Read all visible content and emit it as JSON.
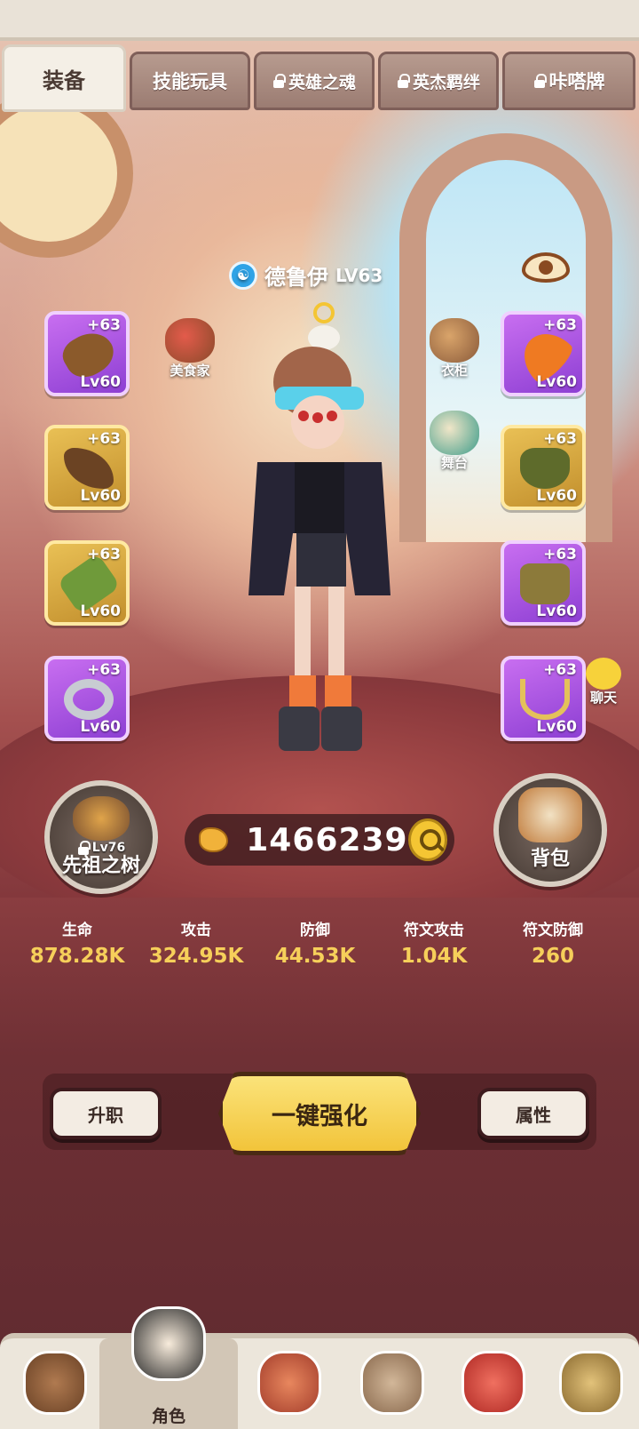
{
  "tabs": [
    {
      "label": "装备",
      "locked": false,
      "active": true
    },
    {
      "label": "技能玩具",
      "locked": false,
      "active": false
    },
    {
      "label": "英雄之魂",
      "locked": true,
      "active": false
    },
    {
      "label": "英杰羁绊",
      "locked": true,
      "active": false
    },
    {
      "label": "咔嗒牌",
      "locked": true,
      "active": false
    }
  ],
  "hero": {
    "name": "德鲁伊",
    "level": "LV63",
    "class_icon": "wind-class-icon"
  },
  "equipment_left": [
    {
      "plus": "+63",
      "level": "Lv60",
      "rarity": "purple",
      "icon": "weapon-staff-icon",
      "color": "#8b5a2b"
    },
    {
      "plus": "+63",
      "level": "Lv60",
      "rarity": "gold",
      "icon": "antler-helmet-icon",
      "color": "#6b4323"
    },
    {
      "plus": "+63",
      "level": "Lv60",
      "rarity": "gold",
      "icon": "bracer-icon",
      "color": "#6f9a3a"
    },
    {
      "plus": "+63",
      "level": "Lv60",
      "rarity": "purple",
      "icon": "ring-icon",
      "color": "#c8ccd2"
    }
  ],
  "equipment_right": [
    {
      "plus": "+63",
      "level": "Lv60",
      "rarity": "purple",
      "icon": "feather-icon",
      "color": "#ef7a22"
    },
    {
      "plus": "+63",
      "level": "Lv60",
      "rarity": "gold",
      "icon": "leaf-armor-icon",
      "color": "#5e6b2b"
    },
    {
      "plus": "+63",
      "level": "Lv60",
      "rarity": "purple",
      "icon": "boots-icon",
      "color": "#8c7a3a"
    },
    {
      "plus": "+63",
      "level": "Lv60",
      "rarity": "purple",
      "icon": "necklace-icon",
      "color": "#e4c15a"
    }
  ],
  "shortcuts": {
    "gourmet": "美食家",
    "wardrobe": "衣柜",
    "stage": "舞台",
    "chat": "聊天"
  },
  "ancestor_tree": {
    "label": "先祖之树",
    "level": "Lv76",
    "locked": true
  },
  "backpack": {
    "label": "背包"
  },
  "power": {
    "value": "1466239"
  },
  "stats": [
    {
      "name": "生命",
      "value": "878.28K"
    },
    {
      "name": "攻击",
      "value": "324.95K"
    },
    {
      "name": "防御",
      "value": "44.53K"
    },
    {
      "name": "符文攻击",
      "value": "1.04K"
    },
    {
      "name": "符文防御",
      "value": "260"
    }
  ],
  "actions": {
    "promote": "升职",
    "enhance_all": "一键强化",
    "attributes": "属性"
  },
  "nav": [
    {
      "label": "",
      "icon": "bear-home-icon",
      "color": "#8a5a3a",
      "active": false
    },
    {
      "label": "角色",
      "icon": "hero-avatar-icon",
      "color": "#f2e3cf",
      "active": true
    },
    {
      "label": "",
      "icon": "tiki-mask-icon",
      "color": "#d66b4a",
      "active": false
    },
    {
      "label": "",
      "icon": "elder-icon",
      "color": "#b79a7a",
      "active": false
    },
    {
      "label": "",
      "icon": "dino-icon",
      "color": "#e2473f",
      "active": false
    },
    {
      "label": "",
      "icon": "totem-icon",
      "color": "#c7a35b",
      "active": false
    }
  ],
  "colors": {
    "accent_gold": "#f6cf5a",
    "background": "#6e2f35",
    "button_yellow": "#f2c43a"
  }
}
